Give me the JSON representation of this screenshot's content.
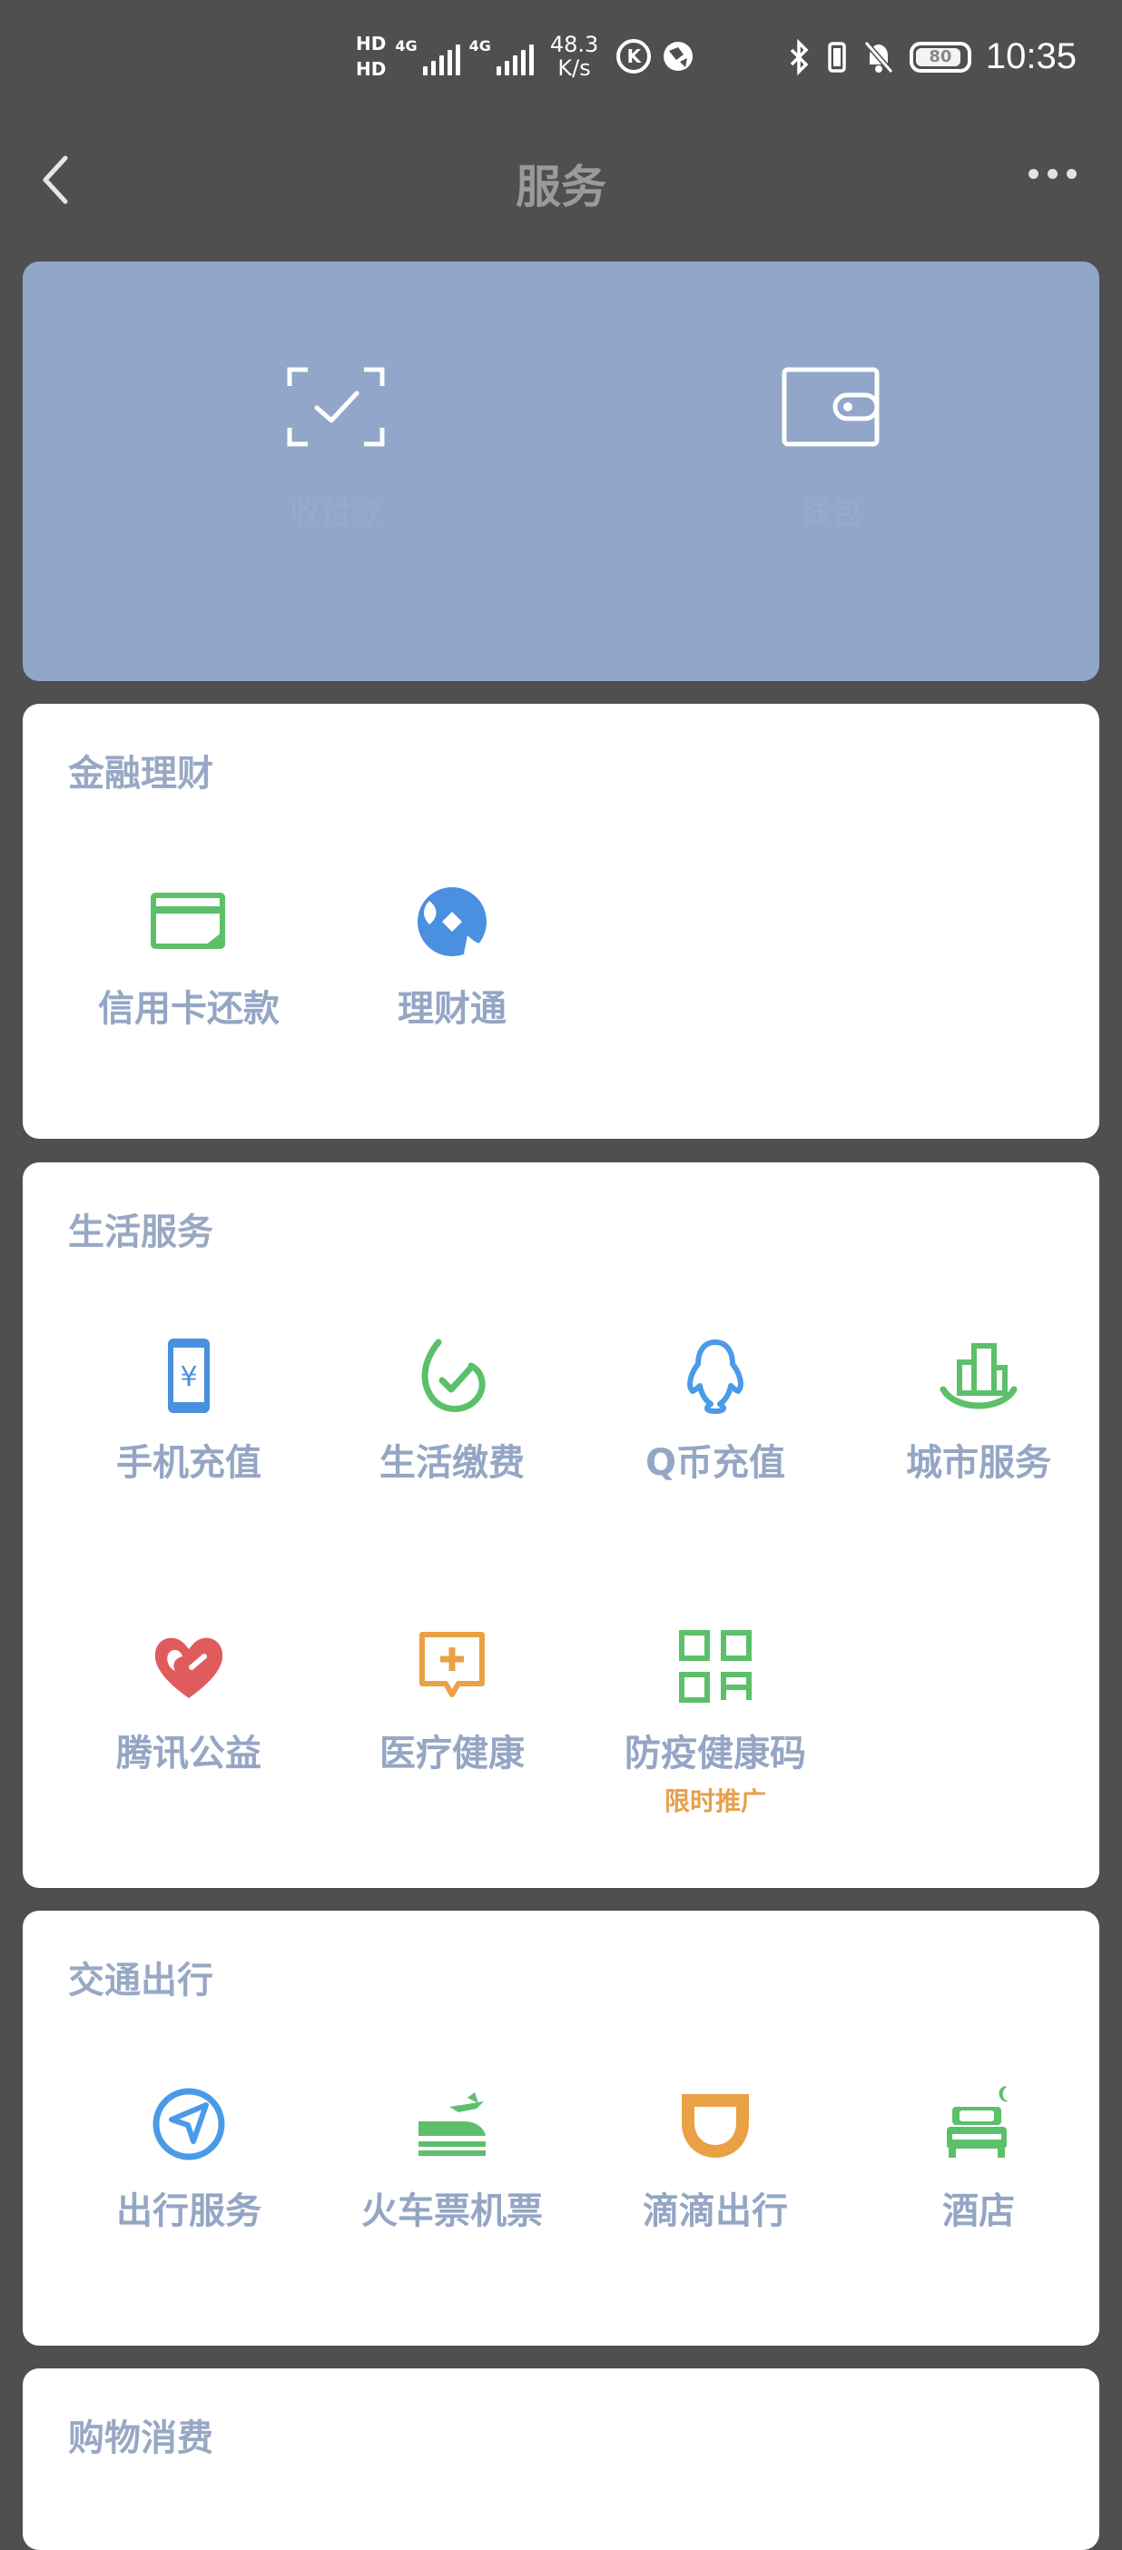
{
  "status_bar": {
    "hd1": "HD",
    "hd2": "HD",
    "net1": "4G",
    "net2": "4G",
    "speed_value": "48.3",
    "speed_unit": "K/s",
    "k_icon": "K",
    "battery": "80",
    "time": "10:35"
  },
  "header": {
    "title": "服务",
    "back_icon": "chevron-left-icon",
    "more_icon": "more-dots-icon"
  },
  "top_card": {
    "items": [
      {
        "icon": "scan-check-icon",
        "label": "收付款"
      },
      {
        "icon": "wallet-icon",
        "label": "钱包"
      }
    ]
  },
  "sections": [
    {
      "title": "金融理财",
      "items": [
        {
          "label": "信用卡还款",
          "icon": "credit-card-icon"
        },
        {
          "label": "理财通",
          "icon": "wealth-icon"
        }
      ]
    },
    {
      "title": "生活服务",
      "items": [
        {
          "label": "手机充值",
          "icon": "phone-topup-icon"
        },
        {
          "label": "生活缴费",
          "icon": "bill-pay-icon"
        },
        {
          "label": "Q币充值",
          "icon": "qq-penguin-icon"
        },
        {
          "label": "城市服务",
          "icon": "city-service-icon"
        },
        {
          "label": "腾讯公益",
          "icon": "charity-heart-icon"
        },
        {
          "label": "医疗健康",
          "icon": "medical-icon"
        },
        {
          "label": "防疫健康码",
          "icon": "qr-code-icon",
          "sub": "限时推广"
        }
      ]
    },
    {
      "title": "交通出行",
      "items": [
        {
          "label": "出行服务",
          "icon": "navigation-icon"
        },
        {
          "label": "火车票机票",
          "icon": "train-plane-icon"
        },
        {
          "label": "滴滴出行",
          "icon": "didi-icon"
        },
        {
          "label": "酒店",
          "icon": "hotel-bed-icon"
        }
      ]
    },
    {
      "title": "购物消费"
    }
  ],
  "colors": {
    "background": "#4f4f4f",
    "top_card": "#92a6c9",
    "label": "#94a6c4",
    "green": "#5cc06a",
    "blue": "#4a8fe0",
    "orange": "#eaa145",
    "red": "#e05b5b"
  }
}
